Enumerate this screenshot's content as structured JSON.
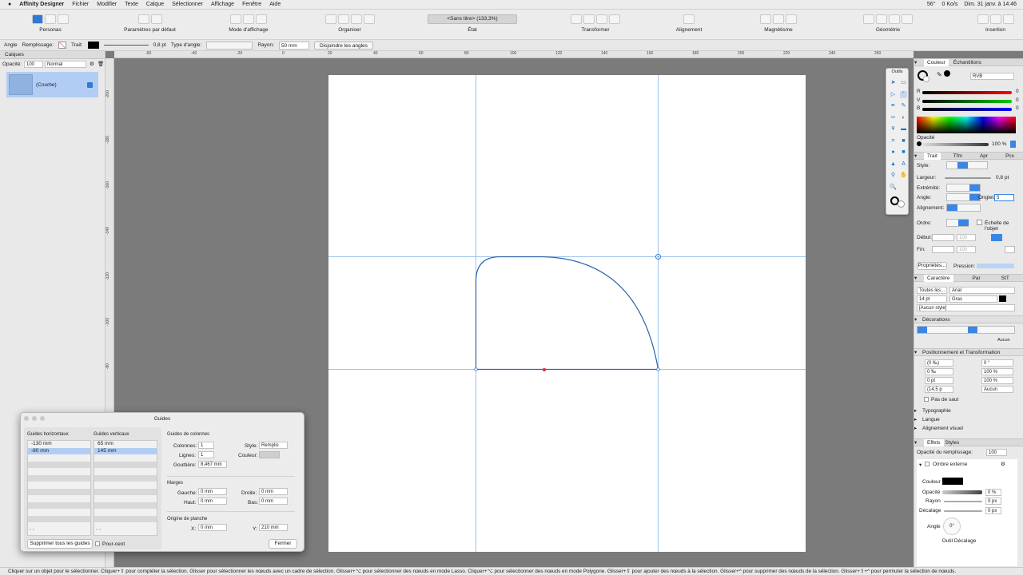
{
  "menubar": {
    "app": "Affinity Designer",
    "items": [
      "Fichier",
      "Modifier",
      "Texte",
      "Calque",
      "Sélectionner",
      "Affichage",
      "Fenêtre",
      "Aide"
    ],
    "temp": "56°",
    "netspeed": "0 Ko/s",
    "datetime": "Dim. 31 janv. à 14:46"
  },
  "toolbar": {
    "personas": "Personas",
    "defaults": "Paramètres par défaut",
    "view_mode": "Mode d'affichage",
    "arrange": "Organiser",
    "doc_title": "<Sans titre> (133,3%)",
    "state": "État",
    "transform": "Transformer",
    "align": "Alignement",
    "snapping": "Magnétisme",
    "geometry": "Géométrie",
    "insert": "Insertion"
  },
  "context": {
    "tool_label": "Angle",
    "fill_label": "Remplissage:",
    "stroke_label": "Trait:",
    "stroke_width": "0,8 pt",
    "corner_type_label": "Type d'angle:",
    "radius_label": "Rayon:",
    "radius_value": "50 mm",
    "split_button": "Disjoindre les angles"
  },
  "layers": {
    "tab": "Calques",
    "opacity_label": "Opacité:",
    "opacity_value": "100",
    "blend_mode": "Normal",
    "items": [
      {
        "name": "(Courbe)",
        "visible": true
      }
    ]
  },
  "rulers": {
    "top": [
      "-60",
      "-40",
      "-20",
      "0",
      "20",
      "40",
      "60",
      "80",
      "100",
      "120",
      "140",
      "160",
      "180",
      "200",
      "220",
      "240",
      "260"
    ],
    "left": [
      "-200",
      "-180",
      "-160",
      "-140",
      "-120",
      "-100",
      "-80"
    ]
  },
  "tool_panel": {
    "title": "Outils"
  },
  "color_panel": {
    "tabs": [
      "Couleur",
      "Échantillons"
    ],
    "model": "RVB",
    "r_label": "R",
    "g_label": "V",
    "b_label": "B",
    "r_value": "0",
    "g_value": "0",
    "b_value": "0",
    "opacity_label": "Opacité",
    "opacity_value": "100 %",
    "accent": "#3a86e6"
  },
  "stroke_panel": {
    "tabs": [
      "Trait",
      "Tfm",
      "Apr",
      "Pcx"
    ],
    "style_label": "Style:",
    "width_label": "Largeur:",
    "width_value": "0,8 pt",
    "cap_label": "Extrémité:",
    "join_label": "Angle:",
    "miter_label": "Onglet:",
    "miter_value": "5",
    "align_label": "Alignement:",
    "order_label": "Ordre:",
    "scale_label": "Échelle de l'objet",
    "start_label": "Début:",
    "end_label": "Fin:",
    "arrow_size": "100",
    "props_button": "Propriétés...",
    "pressure_label": "Pression:"
  },
  "char_panel": {
    "tabs": [
      "Caractère",
      "Par",
      "StT"
    ],
    "font_collection": "Toutes les...",
    "font": "Arial",
    "size": "14 pt",
    "weight": "Gras",
    "style": "[Aucun style]",
    "decorations": "Décorations",
    "deco_none": "Aucun",
    "positioning": "Positionnement et Transformation",
    "pos_values": [
      "(0 ‰)",
      "0 ‰",
      "0 pt",
      "(14,5 p",
      "0 °",
      "100 %",
      "100 %",
      "Aucun"
    ],
    "no_break": "Pas de saut",
    "typography": "Typographie",
    "language": "Langue",
    "visual_align": "Alignement visuel"
  },
  "effects_panel": {
    "tabs": [
      "Effets",
      "Styles"
    ],
    "fill_opacity_label": "Opacité du remplissage:",
    "fill_opacity_value": "100",
    "outer_shadow": "Ombre externe",
    "color_label": "Couleur",
    "opacity_label": "Opacité",
    "opacity_value": "0 %",
    "radius_label": "Rayon",
    "radius_value": "0 px",
    "offset_label": "Décalage",
    "offset_value": "0 px",
    "angle_label": "Angle",
    "angle_value": "0°",
    "offset_tool": "Outil Décalage"
  },
  "guides_dialog": {
    "title": "Guides",
    "h_label": "Guides horizontaux",
    "v_label": "Guides verticaux",
    "h_guides": [
      "-130 mm",
      "-80 mm"
    ],
    "v_guides": [
      "65 mm",
      "145 mm"
    ],
    "columns_label": "Guides de colonnes",
    "columns": "Colonnes:",
    "columns_value": "1",
    "rows": "Lignes:",
    "rows_value": "1",
    "gutter": "Gouttière:",
    "gutter_value": "8,467 mm",
    "style_label": "Style:",
    "style_value": "Remplis",
    "color_label": "Couleur:",
    "margins_label": "Marges",
    "left": "Gauche:",
    "left_value": "0 mm",
    "right": "Droite:",
    "right_value": "0 mm",
    "top": "Haut:",
    "top_value": "0 mm",
    "bottom": "Bas:",
    "bottom_value": "0 mm",
    "origin_label": "Origine de planche",
    "x_label": "X:",
    "x_value": "0 mm",
    "y_label": "Y:",
    "y_value": "210 mm",
    "delete_all": "Supprimer tous les guides",
    "percent": "Pour-cent",
    "close": "Fermer"
  },
  "status_bar": {
    "text": "Cliquer sur un objet pour le sélectionner. Cliquer+⇧ pour compléter la sélection. Glisser pour sélectionner les nœuds avec un cadre de sélection. Glisser+⌥ pour sélectionner des nœuds en mode Lasso. Cliquer+⌥ pour sélectionner des nœuds en mode Polygone. Glisser+⇧ pour ajouter des nœuds à la sélection. Glisser+^ pour supprimer des nœuds de la sélection. Glisser+⇧+^ pour permuter la sélection de nœuds."
  }
}
